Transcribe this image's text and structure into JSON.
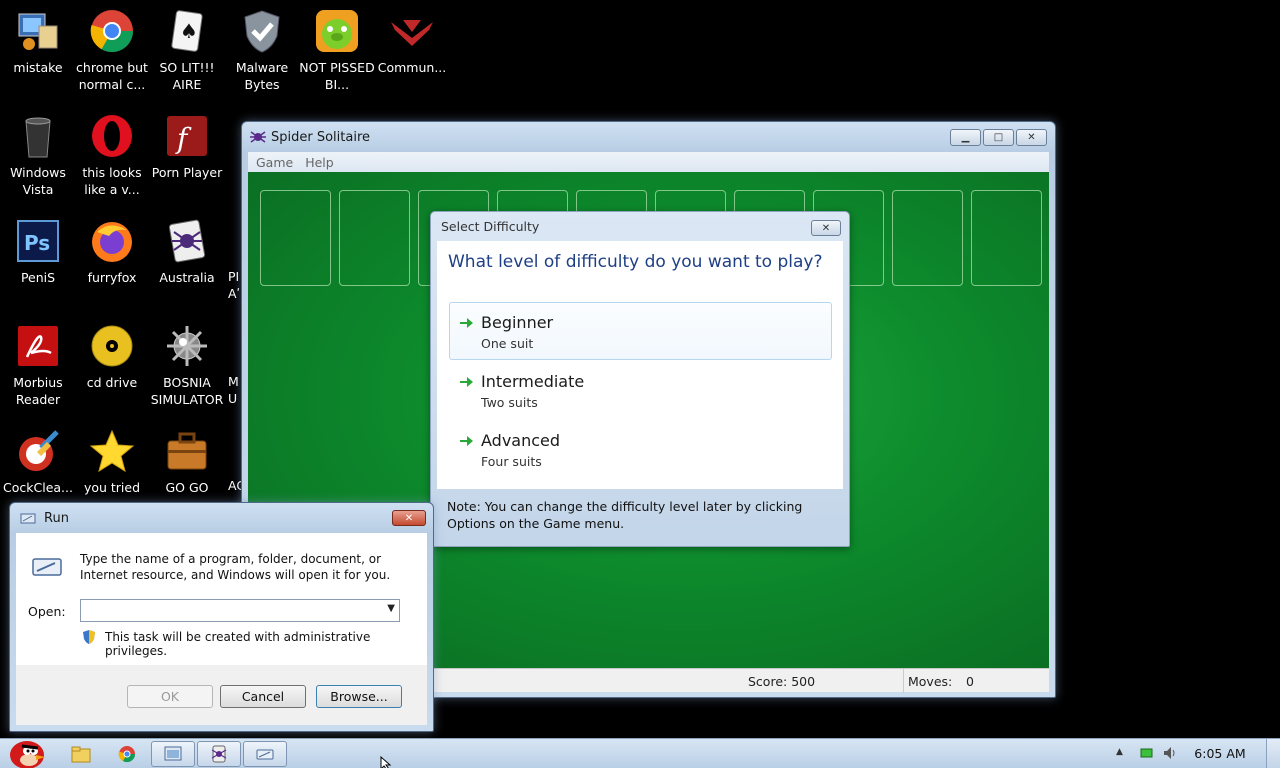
{
  "desktop": {
    "icons": [
      {
        "label": "mistake",
        "icon": "computer-icon"
      },
      {
        "label": "chrome but normal c...",
        "icon": "chrome-icon"
      },
      {
        "label": "SO LIT!!! AIRE",
        "icon": "solitaire-icon"
      },
      {
        "label": "Malware Bytes",
        "icon": "shield-check-icon"
      },
      {
        "label": "NOT PISSED BI...",
        "icon": "angry-birds-pig-icon"
      },
      {
        "label": "Commun...",
        "icon": "communist-bird-icon"
      },
      {
        "label": "Windows Vista",
        "icon": "recycle-bin-icon"
      },
      {
        "label": "this looks like a v...",
        "icon": "opera-icon"
      },
      {
        "label": "Porn Player",
        "icon": "flash-icon"
      },
      {
        "label": "PeniS",
        "icon": "photoshop-icon"
      },
      {
        "label": "furryfox",
        "icon": "firefox-icon"
      },
      {
        "label": "Australia",
        "icon": "spider-solitaire-icon"
      },
      {
        "label": "Morbius Reader",
        "icon": "pdf-reader-icon"
      },
      {
        "label": "cd drive",
        "icon": "cd-icon"
      },
      {
        "label": "BOSNIA SIMULATOR",
        "icon": "mine-icon"
      },
      {
        "label": "CockClea...",
        "icon": "ccleaner-icon"
      },
      {
        "label": "you tried",
        "icon": "star-icon"
      },
      {
        "label": "GO GO",
        "icon": "briefcase-icon"
      }
    ],
    "partial_labels": [
      "PI",
      "Aʹ",
      "M",
      "U",
      "AC"
    ]
  },
  "spider": {
    "title": "Spider Solitaire",
    "menu": [
      "Game",
      "Help"
    ],
    "score_label": "Score: 500",
    "moves_label": "Moves:",
    "moves_value": "0"
  },
  "difficulty": {
    "title": "Select Difficulty",
    "question": "What level of difficulty do you want to play?",
    "options": [
      {
        "title": "Beginner",
        "sub": "One suit"
      },
      {
        "title": "Intermediate",
        "sub": "Two suits"
      },
      {
        "title": "Advanced",
        "sub": "Four suits"
      }
    ],
    "note": "Note: You can change the difficulty level later by clicking Options on the Game menu."
  },
  "run": {
    "title": "Run",
    "description": "Type the name of a program, folder, document, or Internet resource, and Windows will open it for you.",
    "open_label": "Open:",
    "open_value": "",
    "admin_note": "This task will be created with administrative privileges.",
    "ok": "OK",
    "cancel": "Cancel",
    "browse": "Browse..."
  },
  "taskbar": {
    "clock": "6:05 AM"
  },
  "colors": {
    "felt": "#0d8a2c",
    "dialog_heading": "#1e3f84",
    "arrow": "#2aa83a"
  }
}
